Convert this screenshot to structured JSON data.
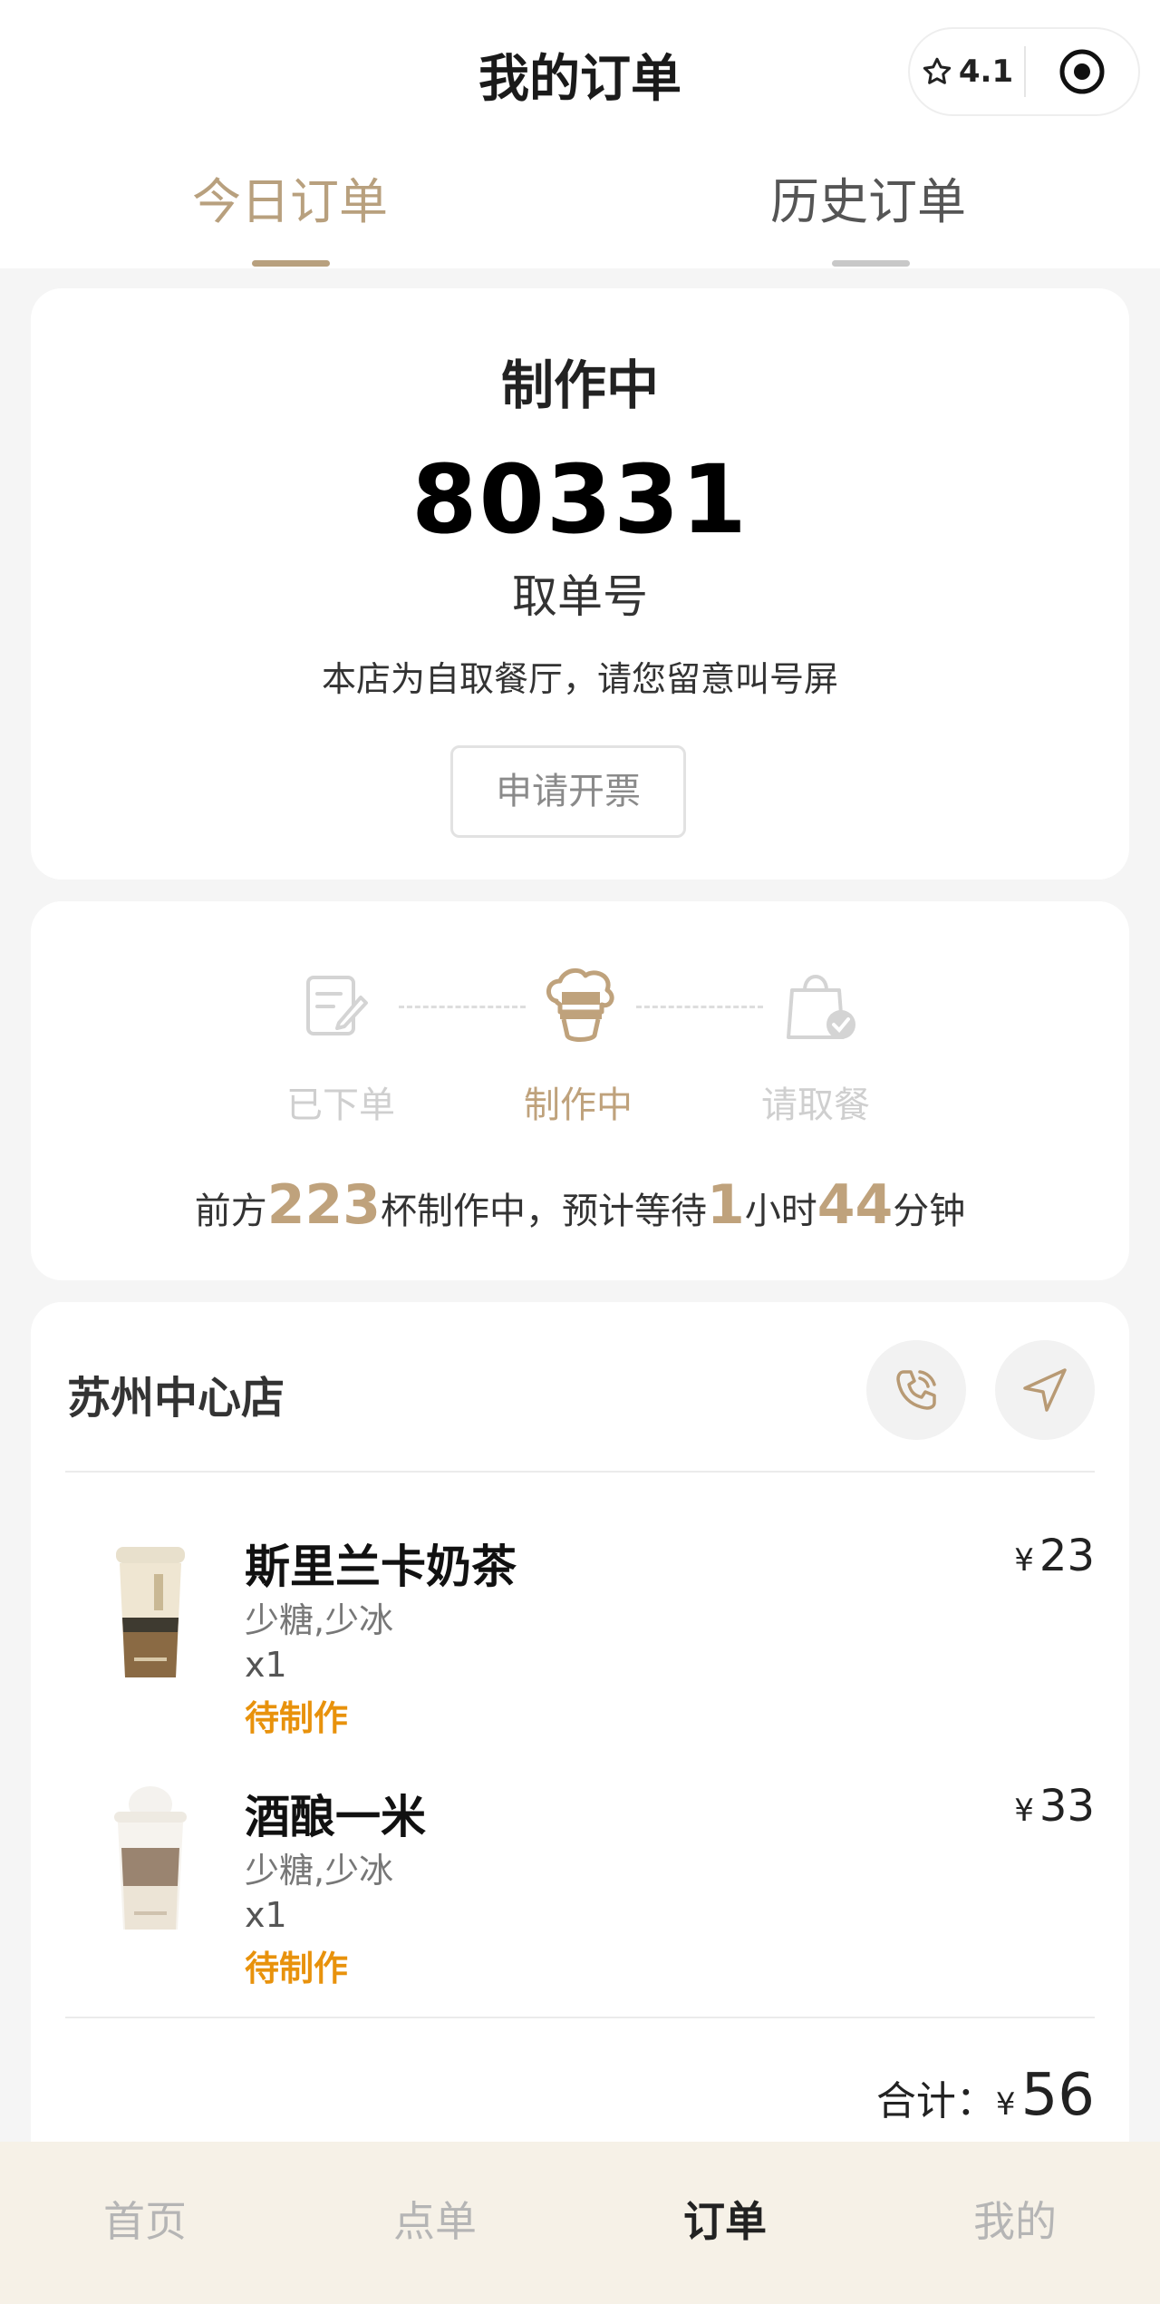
{
  "header": {
    "title": "我的订单",
    "rating": "4.1"
  },
  "tabs": [
    {
      "label": "今日订单",
      "active": true
    },
    {
      "label": "历史订单",
      "active": false
    }
  ],
  "status_card": {
    "status": "制作中",
    "pickup_number": "80331",
    "pickup_label": "取单号",
    "notice": "本店为自取餐厅，请您留意叫号屏",
    "invoice_button": "申请开票"
  },
  "progress": {
    "steps": [
      {
        "label": "已下单",
        "icon": "note-edit-icon",
        "state": "done"
      },
      {
        "label": "制作中",
        "icon": "chef-hat-icon",
        "state": "active"
      },
      {
        "label": "请取餐",
        "icon": "shopping-bag-check-icon",
        "state": "pending"
      }
    ],
    "queue": {
      "prefix": "前方",
      "cups": "223",
      "mid": "杯制作中，预计等待",
      "hours": "1",
      "hours_unit": "小时",
      "minutes": "44",
      "minutes_unit": "分钟"
    }
  },
  "store": {
    "name": "苏州中心店",
    "phone_icon": "phone-icon",
    "navigate_icon": "navigation-arrow-icon"
  },
  "items": [
    {
      "name": "斯里兰卡奶茶",
      "spec": "少糖,少冰",
      "qty": "x1",
      "status": "待制作",
      "currency": "¥",
      "price": "23"
    },
    {
      "name": "酒酿一米",
      "spec": "少糖,少冰",
      "qty": "x1",
      "status": "待制作",
      "currency": "¥",
      "price": "33"
    }
  ],
  "total": {
    "label": "合计：",
    "currency": "¥",
    "amount": "56"
  },
  "tabbar": [
    {
      "label": "首页",
      "active": false
    },
    {
      "label": "点单",
      "active": false
    },
    {
      "label": "订单",
      "active": true
    },
    {
      "label": "我的",
      "active": false
    }
  ],
  "colors": {
    "accent": "#b8a07e",
    "status_orange": "#e8920c",
    "tabbar_bg": "#f6f1e7"
  }
}
